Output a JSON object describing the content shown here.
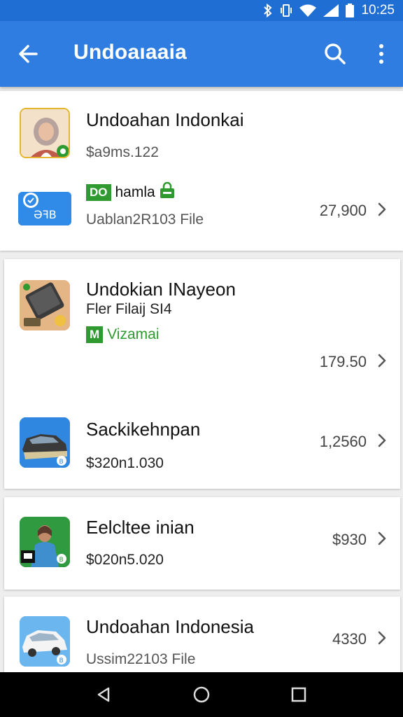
{
  "status_bar": {
    "time": "10:25",
    "icons": [
      "bluetooth-icon",
      "vibrate-icon",
      "wifi-icon",
      "signal-icon",
      "battery-icon"
    ]
  },
  "app_bar": {
    "title": "Undoaıaaia",
    "icons": [
      "back-arrow-icon",
      "search-icon",
      "more-vert-icon"
    ]
  },
  "colors": {
    "primary": "#2f7de1",
    "status": "#1f6ed4",
    "green": "#2f9a2f"
  },
  "items": [
    {
      "name": "Undoahan Indonkai",
      "subtitle": "$a9ms.122",
      "tag_box": "DO",
      "tag_label": "hamla",
      "secondary_sub": "Uablan2R103 File",
      "price": "27,900"
    },
    {
      "name": "Undokian INayeon",
      "subtitle": "Fler Filaij SI4",
      "tag_box": "M",
      "tag_label": "Vizamai",
      "price": "179.50"
    },
    {
      "name": "Sackikehnpan",
      "subtitle": "$320n1.030",
      "price": "1,2560"
    },
    {
      "name": "Eelcltee inian",
      "subtitle": "$020n5.020",
      "price": "$930"
    },
    {
      "name": "Undoahan Indonesia",
      "subtitle": "Ussim22103 File",
      "price": "4330"
    }
  ],
  "nav_bar": {
    "icons": [
      "back-triangle-icon",
      "home-circle-icon",
      "recents-square-icon"
    ]
  }
}
